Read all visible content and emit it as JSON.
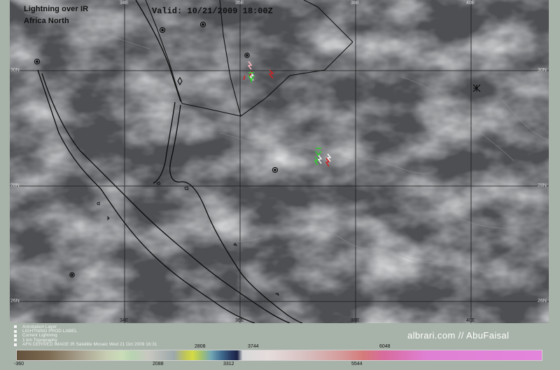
{
  "header": {
    "title_line1": "Lightning over IR",
    "title_line2": "Africa North",
    "valid": "Valid: 10/21/2009 18:00Z"
  },
  "axes": {
    "top_lon": [
      "34E",
      "36E",
      "38E",
      "40E"
    ],
    "bottom_lon": [
      "34E",
      "36E",
      "38E",
      "40E"
    ],
    "lat_left": [
      "30N",
      "28N",
      "26N"
    ],
    "lat_right": [
      "30N",
      "28N",
      "26N"
    ]
  },
  "legend": {
    "items": [
      "Annotation Layer",
      "LIGHTNING PROD LABEL",
      "Current Lightning",
      "1 km Topography",
      "AFN DERIVED IMAGE IR Satellite Mosaic Wed 21 Oct 2009 16:31"
    ]
  },
  "colorbar": {
    "top_labels": [
      "2808",
      "3744",
      "6048"
    ],
    "bottom_labels": [
      "-360",
      "2088",
      "3312",
      "5544"
    ]
  },
  "watermark": "albrari.com // AbuFaisal",
  "colors": {
    "map_background": "#4d4f53",
    "frame": "#a7b2a9",
    "lightning_red": "#d22020",
    "lightning_green": "#2ccf2c",
    "lightning_pink": "#ffb6c1",
    "lightning_white": "#f4f4f4"
  }
}
